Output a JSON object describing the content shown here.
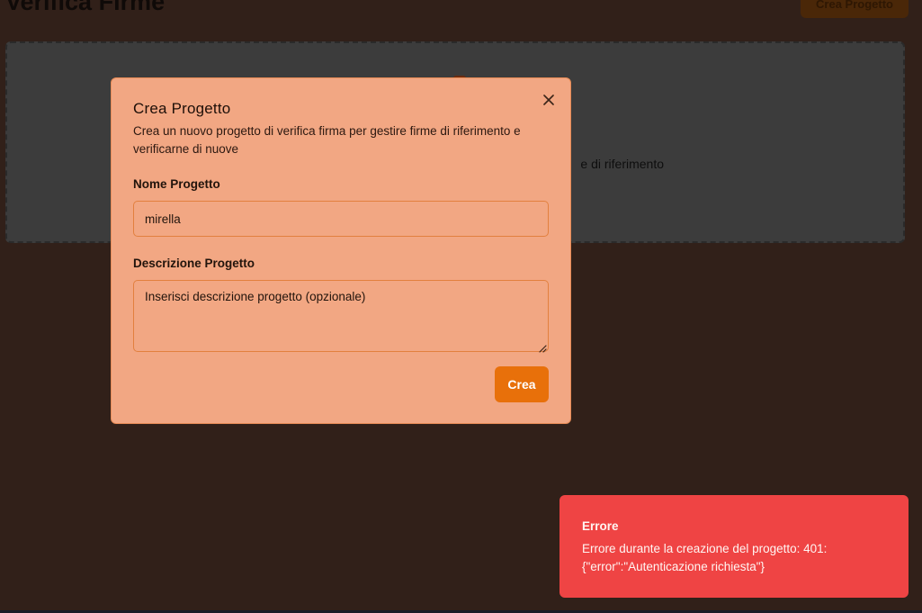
{
  "page": {
    "title": "Verifica Firme",
    "header_button_label": "Crea Progetto",
    "dropzone_text": "e di riferimento"
  },
  "modal": {
    "title": "Crea Progetto",
    "description": "Crea un nuovo progetto di verifica firma per gestire firme di riferimento e verificarne di nuove",
    "close_icon": "close-icon",
    "name_label": "Nome Progetto",
    "name_value": "mirella",
    "description_label": "Descrizione Progetto",
    "description_placeholder": "Inserisci descrizione progetto (opzionale)",
    "description_value": "",
    "submit_label": "Crea"
  },
  "toast": {
    "title": "Errore",
    "message": "Errore durante la creazione del progetto: 401: {\"error\":\"Autenticazione richiesta\"}"
  },
  "colors": {
    "background": "#312019",
    "modal_bg": "#f2a783",
    "accent": "#e8700a",
    "error": "#ef4444",
    "dropzone": "#3c3c3c"
  }
}
